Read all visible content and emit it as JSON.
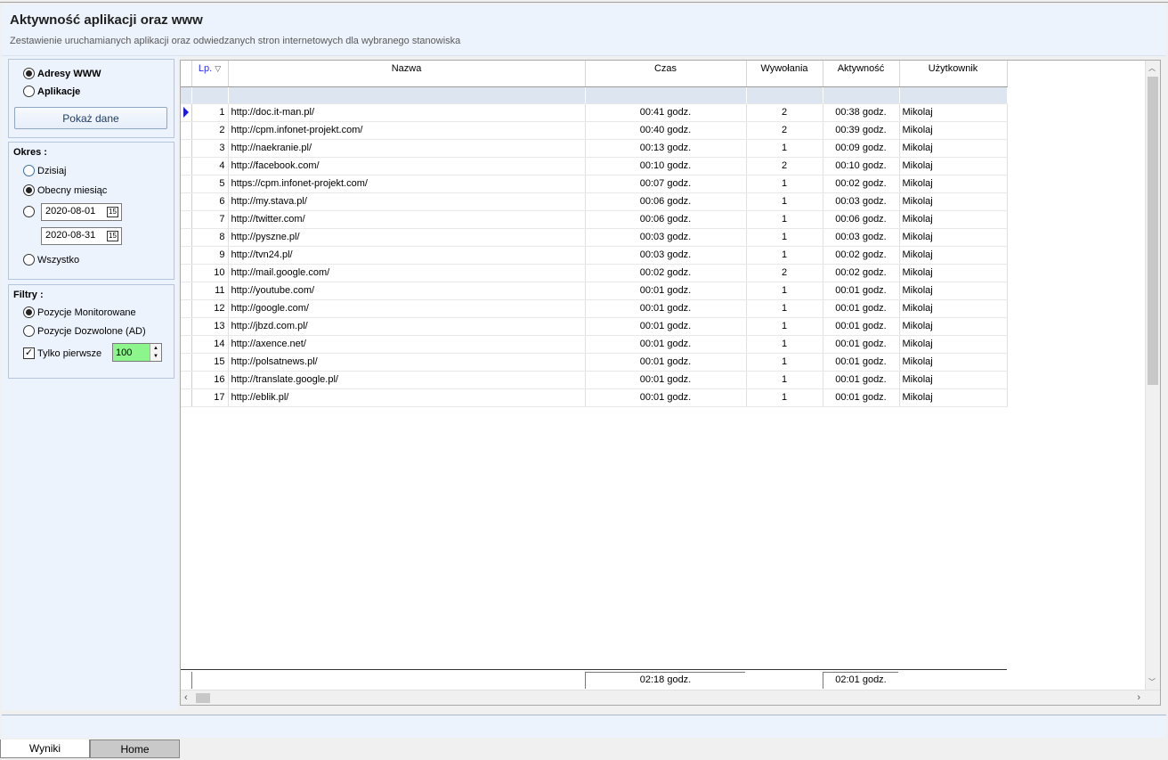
{
  "header": {
    "title": "Aktywność aplikacji oraz www",
    "subtitle": "Zestawienie uruchamianych aplikacji oraz odwiedzanych stron internetowych dla wybranego stanowiska"
  },
  "source": {
    "options": [
      "Adresy WWW",
      "Aplikacje"
    ],
    "selected": "Adresy WWW",
    "show_button": "Pokaż dane"
  },
  "period": {
    "title": "Okres :",
    "today": "Dzisiaj",
    "current_month": "Obecny miesiąc",
    "selected": "Obecny miesiąc",
    "date_from": "2020-08-01",
    "date_to": "2020-08-31",
    "all": "Wszystko",
    "calendar_icon": "calendar-icon",
    "calendar_glyph": "15"
  },
  "filters": {
    "title": "Filtry :",
    "monitored": "Pozycje Monitorowane",
    "allowed": "Pozycje Dozwolone (AD)",
    "selected": "Pozycje Monitorowane",
    "only_first_label": "Tylko pierwsze",
    "only_first_checked": true,
    "only_first_value": "100",
    "spin_color": "#8cf58c"
  },
  "grid": {
    "columns": [
      "Lp.",
      "Nazwa",
      "Czas",
      "Wywołania",
      "Aktywność",
      "Użytkownik"
    ],
    "sort_icon": "sort-icon",
    "rows": [
      [
        "1",
        "http://doc.it-man.pl/",
        "00:41 godz.",
        "2",
        "00:38 godz.",
        "Mikolaj"
      ],
      [
        "2",
        "http://cpm.infonet-projekt.com/",
        "00:40 godz.",
        "2",
        "00:39 godz.",
        "Mikolaj"
      ],
      [
        "3",
        "http://naekranie.pl/",
        "00:13 godz.",
        "1",
        "00:09 godz.",
        "Mikolaj"
      ],
      [
        "4",
        "http://facebook.com/",
        "00:10 godz.",
        "2",
        "00:10 godz.",
        "Mikolaj"
      ],
      [
        "5",
        "https://cpm.infonet-projekt.com/",
        "00:07 godz.",
        "1",
        "00:02 godz.",
        "Mikolaj"
      ],
      [
        "6",
        "http://my.stava.pl/",
        "00:06 godz.",
        "1",
        "00:03 godz.",
        "Mikolaj"
      ],
      [
        "7",
        "http://twitter.com/",
        "00:06 godz.",
        "1",
        "00:06 godz.",
        "Mikolaj"
      ],
      [
        "8",
        "http://pyszne.pl/",
        "00:03 godz.",
        "1",
        "00:03 godz.",
        "Mikolaj"
      ],
      [
        "9",
        "http://tvn24.pl/",
        "00:03 godz.",
        "1",
        "00:02 godz.",
        "Mikolaj"
      ],
      [
        "10",
        "http://mail.google.com/",
        "00:02 godz.",
        "2",
        "00:02 godz.",
        "Mikolaj"
      ],
      [
        "11",
        "http://youtube.com/",
        "00:01 godz.",
        "1",
        "00:01 godz.",
        "Mikolaj"
      ],
      [
        "12",
        "http://google.com/",
        "00:01 godz.",
        "1",
        "00:01 godz.",
        "Mikolaj"
      ],
      [
        "13",
        "http://jbzd.com.pl/",
        "00:01 godz.",
        "1",
        "00:01 godz.",
        "Mikolaj"
      ],
      [
        "14",
        "http://axence.net/",
        "00:01 godz.",
        "1",
        "00:01 godz.",
        "Mikolaj"
      ],
      [
        "15",
        "http://polsatnews.pl/",
        "00:01 godz.",
        "1",
        "00:01 godz.",
        "Mikolaj"
      ],
      [
        "16",
        "http://translate.google.pl/",
        "00:01 godz.",
        "1",
        "00:01 godz.",
        "Mikolaj"
      ],
      [
        "17",
        "http://eblik.pl/",
        "00:01 godz.",
        "1",
        "00:01 godz.",
        "Mikolaj"
      ]
    ],
    "current_row": 1,
    "totals": {
      "czas": "02:18 godz.",
      "aktywnosc": "02:01 godz."
    }
  },
  "tabs": [
    {
      "label": "Wyniki",
      "active": true
    },
    {
      "label": "Home",
      "active": false
    }
  ]
}
